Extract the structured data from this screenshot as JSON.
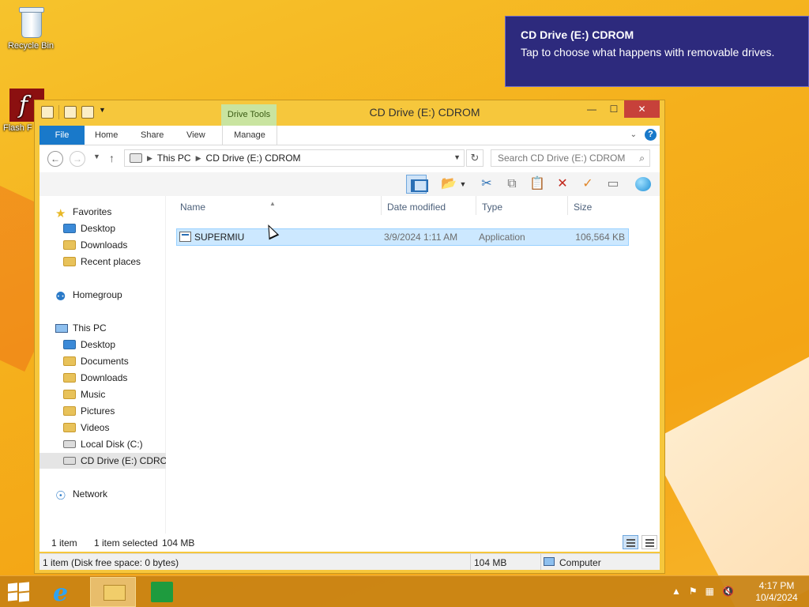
{
  "desktop": {
    "icons": [
      {
        "label": "Recycle Bin",
        "icon": "recycle-bin-icon"
      },
      {
        "label": "Flash F",
        "icon": "flash-icon"
      }
    ]
  },
  "toast": {
    "title": "CD Drive (E:) CDROM",
    "message": "Tap to choose what happens with removable drives."
  },
  "window": {
    "title": "CD Drive (E:) CDROM",
    "context_tab": "Drive Tools",
    "controls": {
      "minimize": "—",
      "maximize": "☐",
      "close": "✕"
    }
  },
  "ribbon": {
    "tabs": [
      "File",
      "Home",
      "Share",
      "View",
      "Manage"
    ],
    "help": "?"
  },
  "address": {
    "path": [
      "This PC",
      "CD Drive (E:) CDROM"
    ],
    "search_placeholder": "Search CD Drive (E:) CDROM"
  },
  "navigation": {
    "favorites": {
      "label": "Favorites",
      "items": [
        "Desktop",
        "Downloads",
        "Recent places"
      ]
    },
    "homegroup": "Homegroup",
    "this_pc": {
      "label": "This PC",
      "items": [
        "Desktop",
        "Documents",
        "Downloads",
        "Music",
        "Pictures",
        "Videos",
        "Local Disk (C:)",
        "CD Drive (E:) CDROM"
      ]
    },
    "network": "Network"
  },
  "columns": [
    "Name",
    "Date modified",
    "Type",
    "Size"
  ],
  "files": [
    {
      "name": "SUPERMIU",
      "date": "3/9/2024 1:11 AM",
      "type": "Application",
      "size": "106,564 KB"
    }
  ],
  "status": {
    "count": "1 item",
    "selected": "1 item selected",
    "size": "104 MB"
  },
  "infobar": {
    "left": "1 item (Disk free space: 0 bytes)",
    "size": "104 MB",
    "location": "Computer"
  },
  "taskbar": {
    "apps": [
      "internet-explorer-icon",
      "file-explorer-icon",
      "store-icon"
    ],
    "time": "4:17 PM",
    "date": "10/4/2024"
  }
}
